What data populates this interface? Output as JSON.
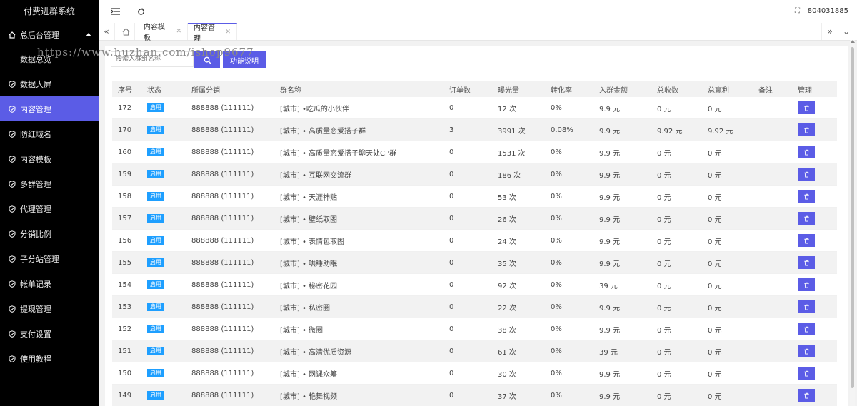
{
  "app": {
    "title": "付费进群系统",
    "user": "804031885"
  },
  "watermark": "https://www.huzhan.com/ishop9677",
  "sidebar": {
    "group": {
      "label": "总后台管理",
      "sub": "数据总览"
    },
    "items": [
      {
        "label": "数据大屏",
        "active": false
      },
      {
        "label": "内容管理",
        "active": true
      },
      {
        "label": "防红域名",
        "active": false
      },
      {
        "label": "内容模板",
        "active": false
      },
      {
        "label": "多群管理",
        "active": false
      },
      {
        "label": "代理管理",
        "active": false
      },
      {
        "label": "分销比例",
        "active": false
      },
      {
        "label": "子分站管理",
        "active": false
      },
      {
        "label": "帐单记录",
        "active": false
      },
      {
        "label": "提现管理",
        "active": false
      },
      {
        "label": "支付设置",
        "active": false
      },
      {
        "label": "使用教程",
        "active": false
      }
    ]
  },
  "tabs": [
    {
      "label": "内容模板",
      "active": false
    },
    {
      "label": "内容管理",
      "active": true
    }
  ],
  "search": {
    "placeholder": "搜索入群组名称",
    "help_label": "功能说明"
  },
  "table": {
    "headers": [
      "序号",
      "状态",
      "所属分销",
      "群名称",
      "订单数",
      "曝光量",
      "转化率",
      "入群金额",
      "总收数",
      "总赢利",
      "备注",
      "管理"
    ],
    "rows": [
      {
        "id": "172",
        "status": "启用",
        "dist": "888888 (111111)",
        "name": "[城市] •吃瓜的小伙伴",
        "orders": "0",
        "views": "12 次",
        "rate": "0%",
        "price": "9.9 元",
        "income": "0 元",
        "profit": "0 元",
        "note": ""
      },
      {
        "id": "170",
        "status": "启用",
        "dist": "888888 (111111)",
        "name": "[城市] • 高质量恋爱搭子群",
        "orders": "3",
        "views": "3991 次",
        "rate": "0.08%",
        "price": "9.9 元",
        "income": "9.92 元",
        "profit": "9.92 元",
        "note": ""
      },
      {
        "id": "160",
        "status": "启用",
        "dist": "888888 (111111)",
        "name": "[城市] • 高质量恋爱搭子聊天处CP群",
        "orders": "0",
        "views": "1531 次",
        "rate": "0%",
        "price": "9.9 元",
        "income": "0 元",
        "profit": "0 元",
        "note": ""
      },
      {
        "id": "159",
        "status": "启用",
        "dist": "888888 (111111)",
        "name": "[城市] • 互联网交流群",
        "orders": "0",
        "views": "186 次",
        "rate": "0%",
        "price": "9.9 元",
        "income": "0 元",
        "profit": "0 元",
        "note": ""
      },
      {
        "id": "158",
        "status": "启用",
        "dist": "888888 (111111)",
        "name": "[城市] • 天涯神贴",
        "orders": "0",
        "views": "53 次",
        "rate": "0%",
        "price": "9.9 元",
        "income": "0 元",
        "profit": "0 元",
        "note": ""
      },
      {
        "id": "157",
        "status": "启用",
        "dist": "888888 (111111)",
        "name": "[城市] • 壁纸取图",
        "orders": "0",
        "views": "26 次",
        "rate": "0%",
        "price": "9.9 元",
        "income": "0 元",
        "profit": "0 元",
        "note": ""
      },
      {
        "id": "156",
        "status": "启用",
        "dist": "888888 (111111)",
        "name": "[城市] • 表情包取图",
        "orders": "0",
        "views": "24 次",
        "rate": "0%",
        "price": "9.9 元",
        "income": "0 元",
        "profit": "0 元",
        "note": ""
      },
      {
        "id": "155",
        "status": "启用",
        "dist": "888888 (111111)",
        "name": "[城市] • 哄睡助眠",
        "orders": "0",
        "views": "35 次",
        "rate": "0%",
        "price": "9.9 元",
        "income": "0 元",
        "profit": "0 元",
        "note": ""
      },
      {
        "id": "154",
        "status": "启用",
        "dist": "888888 (111111)",
        "name": "[城市] • 秘密花园",
        "orders": "0",
        "views": "92 次",
        "rate": "0%",
        "price": "39 元",
        "income": "0 元",
        "profit": "0 元",
        "note": ""
      },
      {
        "id": "153",
        "status": "启用",
        "dist": "888888 (111111)",
        "name": "[城市] • 私密圈",
        "orders": "0",
        "views": "22 次",
        "rate": "0%",
        "price": "9.9 元",
        "income": "0 元",
        "profit": "0 元",
        "note": ""
      },
      {
        "id": "152",
        "status": "启用",
        "dist": "888888 (111111)",
        "name": "[城市] • 微圈",
        "orders": "0",
        "views": "38 次",
        "rate": "0%",
        "price": "9.9 元",
        "income": "0 元",
        "profit": "0 元",
        "note": ""
      },
      {
        "id": "151",
        "status": "启用",
        "dist": "888888 (111111)",
        "name": "[城市] • 高清优质资源",
        "orders": "0",
        "views": "61 次",
        "rate": "0%",
        "price": "39 元",
        "income": "0 元",
        "profit": "0 元",
        "note": ""
      },
      {
        "id": "150",
        "status": "启用",
        "dist": "888888 (111111)",
        "name": "[城市] • 网课众筹",
        "orders": "0",
        "views": "30 次",
        "rate": "0%",
        "price": "9.9 元",
        "income": "0 元",
        "profit": "0 元",
        "note": ""
      },
      {
        "id": "149",
        "status": "启用",
        "dist": "888888 (111111)",
        "name": "[城市] • 艳舞视频",
        "orders": "0",
        "views": "37 次",
        "rate": "0%",
        "price": "9.9 元",
        "income": "0 元",
        "profit": "0 元",
        "note": ""
      }
    ]
  },
  "colors": {
    "accent": "#5b5ce6",
    "badge": "#1e9fff",
    "sidebar_bg": "#000000"
  }
}
